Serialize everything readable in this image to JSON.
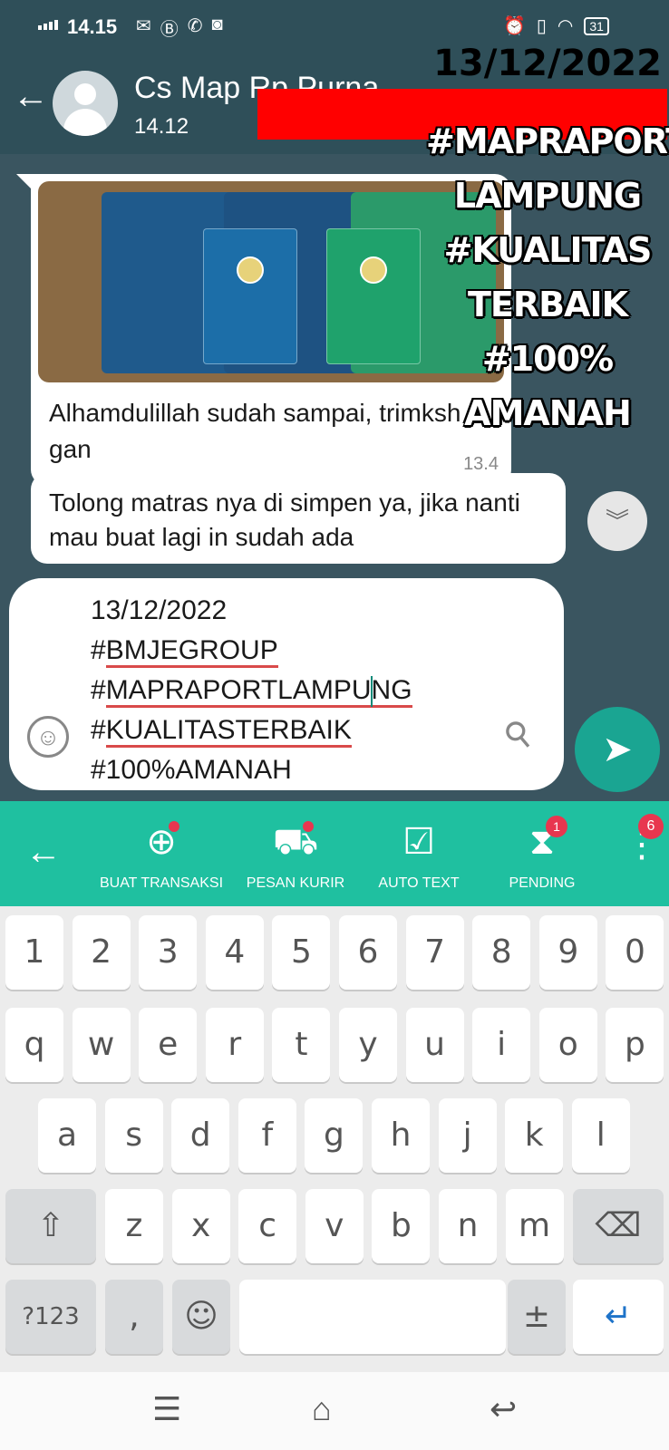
{
  "status_bar": {
    "time": "14.15",
    "battery": "31"
  },
  "header": {
    "contact_name": "Cs Map Rp Purna",
    "last_seen": "14.12"
  },
  "messages": [
    {
      "text": "Alhamdulillah sudah sampai, trimksh gan",
      "time": "13.4"
    },
    {
      "text": "Tolong matras nya di simpen ya, jika nanti mau buat lagi in sudah ada"
    }
  ],
  "overlay": {
    "date": "13/12/2022",
    "lines": [
      "#MAPRAPORT",
      "LAMPUNG",
      "#KUALITAS",
      "TERBAIK",
      "#100%",
      "AMANAH"
    ]
  },
  "composer": {
    "lines": [
      "13/12/2022",
      "#BMJEGROUP",
      "#MAPRAPORTLAMPUNG",
      "#KUALITASTERBAIK",
      "#100%AMANAH"
    ]
  },
  "toolbar": {
    "items": [
      {
        "label": "BUAT TRANSAKSI",
        "icon": "rp-plus-icon"
      },
      {
        "label": "PESAN KURIR",
        "icon": "truck-icon"
      },
      {
        "label": "AUTO TEXT",
        "icon": "clipboard-check-icon"
      },
      {
        "label": "PENDING",
        "icon": "hourglass-icon",
        "badge": "1"
      }
    ],
    "more_badge": "6"
  },
  "keyboard": {
    "row1": [
      "1",
      "2",
      "3",
      "4",
      "5",
      "6",
      "7",
      "8",
      "9",
      "0"
    ],
    "row2": [
      "q",
      "w",
      "e",
      "r",
      "t",
      "y",
      "u",
      "i",
      "o",
      "p"
    ],
    "row3": [
      "a",
      "s",
      "d",
      "f",
      "g",
      "h",
      "j",
      "k",
      "l"
    ],
    "row4": [
      "z",
      "x",
      "c",
      "v",
      "b",
      "n",
      "m"
    ],
    "symbols_label": "?123",
    "comma": ","
  },
  "colors": {
    "header": "#2f4f59",
    "toolbar": "#1fc0a0",
    "send": "#1aa592",
    "redaction": "#ff0000"
  }
}
